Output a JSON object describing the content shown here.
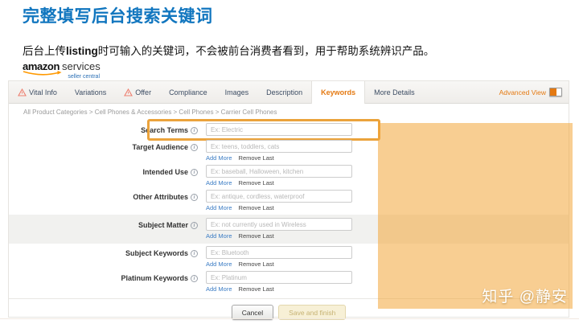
{
  "page": {
    "title": "完整填写后台搜索关键词",
    "subtitle_pre": "后台上传",
    "subtitle_bold": "listing",
    "subtitle_post": "时可输入的关键词，不会被前台消费者看到，用于帮助系统辨识产品。",
    "watermark": "知乎 @静安"
  },
  "logo": {
    "brand": "amazon",
    "suffix": "services",
    "sub": "seller central"
  },
  "tabs": [
    {
      "label": "Vital Info",
      "warning": true,
      "active": false
    },
    {
      "label": "Variations",
      "warning": false,
      "active": false
    },
    {
      "label": "Offer",
      "warning": true,
      "active": false
    },
    {
      "label": "Compliance",
      "warning": false,
      "active": false
    },
    {
      "label": "Images",
      "warning": false,
      "active": false
    },
    {
      "label": "Description",
      "warning": false,
      "active": false
    },
    {
      "label": "Keywords",
      "warning": false,
      "active": true
    },
    {
      "label": "More Details",
      "warning": false,
      "active": false
    }
  ],
  "advanced_view": {
    "label": "Advanced View",
    "state": "on"
  },
  "breadcrumb": "All Product Categories > Cell Phones & Accessories > Cell Phones > Carrier Cell Phones",
  "form": {
    "fields": [
      {
        "label": "Search Terms",
        "placeholder": "Ex: Electric",
        "highlighted": true,
        "links": false,
        "shaded": false
      },
      {
        "label": "Target Audience",
        "placeholder": "Ex: teens, toddlers, cats",
        "highlighted": false,
        "links": true,
        "shaded": false
      },
      {
        "label": "Intended Use",
        "placeholder": "Ex: baseball, Halloween, kitchen",
        "highlighted": false,
        "links": true,
        "shaded": false
      },
      {
        "label": "Other Attributes",
        "placeholder": "Ex: antique, cordless, waterproof",
        "highlighted": false,
        "links": true,
        "shaded": false
      },
      {
        "label": "Subject Matter",
        "placeholder": "Ex: not currently used in Wireless",
        "highlighted": false,
        "links": true,
        "shaded": true
      },
      {
        "label": "Subject Keywords",
        "placeholder": "Ex: Bluetooth",
        "highlighted": false,
        "links": true,
        "shaded": false
      },
      {
        "label": "Platinum Keywords",
        "placeholder": "Ex: Platinum",
        "highlighted": false,
        "links": true,
        "shaded": false
      }
    ],
    "add_more_label": "Add More",
    "remove_last_label": "Remove Last",
    "cancel_label": "Cancel",
    "save_label": "Save and finish"
  },
  "icons": {
    "info": "i"
  },
  "colors": {
    "title_blue": "#1176bf",
    "accent_orange": "#e47911",
    "highlight_border": "#eba33c",
    "overlay_orange": "#f3a638",
    "link_blue": "#3b7cc4"
  }
}
